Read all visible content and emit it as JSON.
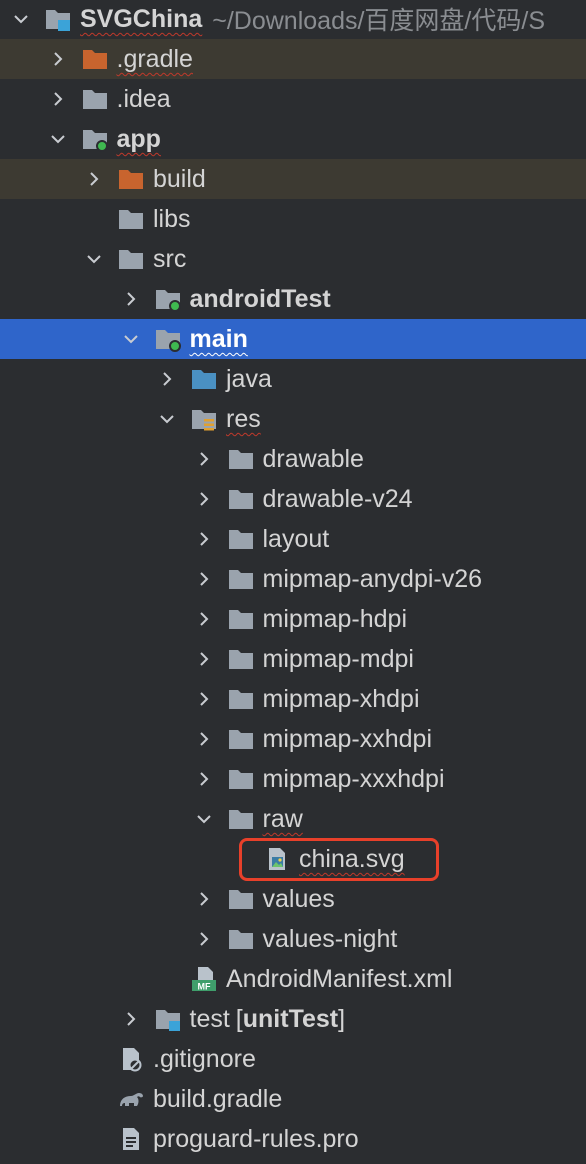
{
  "project": {
    "name": "SVGChina",
    "path": "~/Downloads/百度网盘/代码/S"
  },
  "tree": [
    {
      "label": "SVGChina",
      "icon": "module-folder",
      "state": "expanded",
      "depth": 0,
      "bold": true
    },
    {
      "label": ".gradle",
      "icon": "folder-orange",
      "state": "collapsed",
      "depth": 1
    },
    {
      "label": ".idea",
      "icon": "folder",
      "state": "collapsed",
      "depth": 1
    },
    {
      "label": "app",
      "icon": "module-folder-green",
      "state": "expanded",
      "depth": 1,
      "bold": true
    },
    {
      "label": "build",
      "icon": "folder-orange",
      "state": "collapsed",
      "depth": 2
    },
    {
      "label": "libs",
      "icon": "folder",
      "state": "none",
      "depth": 2
    },
    {
      "label": "src",
      "icon": "folder",
      "state": "expanded",
      "depth": 2
    },
    {
      "label": "androidTest",
      "icon": "source-folder-green",
      "state": "collapsed",
      "depth": 3,
      "bold": true
    },
    {
      "label": "main",
      "icon": "source-folder-green",
      "state": "expanded",
      "depth": 3,
      "bold": true,
      "selected": true
    },
    {
      "label": "java",
      "icon": "folder-blue",
      "state": "collapsed",
      "depth": 4
    },
    {
      "label": "res",
      "icon": "res-folder",
      "state": "expanded",
      "depth": 4
    },
    {
      "label": "drawable",
      "icon": "folder",
      "state": "collapsed",
      "depth": 5
    },
    {
      "label": "drawable-v24",
      "icon": "folder",
      "state": "collapsed",
      "depth": 5
    },
    {
      "label": "layout",
      "icon": "folder",
      "state": "collapsed",
      "depth": 5
    },
    {
      "label": "mipmap-anydpi-v26",
      "icon": "folder",
      "state": "collapsed",
      "depth": 5
    },
    {
      "label": "mipmap-hdpi",
      "icon": "folder",
      "state": "collapsed",
      "depth": 5
    },
    {
      "label": "mipmap-mdpi",
      "icon": "folder",
      "state": "collapsed",
      "depth": 5
    },
    {
      "label": "mipmap-xhdpi",
      "icon": "folder",
      "state": "collapsed",
      "depth": 5
    },
    {
      "label": "mipmap-xxhdpi",
      "icon": "folder",
      "state": "collapsed",
      "depth": 5
    },
    {
      "label": "mipmap-xxxhdpi",
      "icon": "folder",
      "state": "collapsed",
      "depth": 5
    },
    {
      "label": "raw",
      "icon": "folder",
      "state": "expanded",
      "depth": 5
    },
    {
      "label": "china.svg",
      "icon": "image-file",
      "state": "none",
      "depth": 6
    },
    {
      "label": "values",
      "icon": "folder",
      "state": "collapsed",
      "depth": 5
    },
    {
      "label": "values-night",
      "icon": "folder",
      "state": "collapsed",
      "depth": 5
    },
    {
      "label": "AndroidManifest.xml",
      "icon": "manifest-file",
      "state": "none",
      "depth": 4
    },
    {
      "label": "test",
      "extra": "unitTest",
      "icon": "test-folder",
      "state": "collapsed",
      "depth": 3
    },
    {
      "label": ".gitignore",
      "icon": "ignore-file",
      "state": "none",
      "depth": 2
    },
    {
      "label": "build.gradle",
      "icon": "gradle-file",
      "state": "none",
      "depth": 2
    },
    {
      "label": "proguard-rules.pro",
      "icon": "text-file",
      "state": "none",
      "depth": 2
    }
  ],
  "colors": {
    "background": "#2b2d30",
    "selected_row": "#2f65ca",
    "excluded_row": "#3d3a32",
    "folder": "#9aa3ad",
    "folder_orange": "#c8642e",
    "folder_blue": "#4a90c2",
    "module_dot": "#3fb950",
    "highlight_box": "#e8402a"
  }
}
